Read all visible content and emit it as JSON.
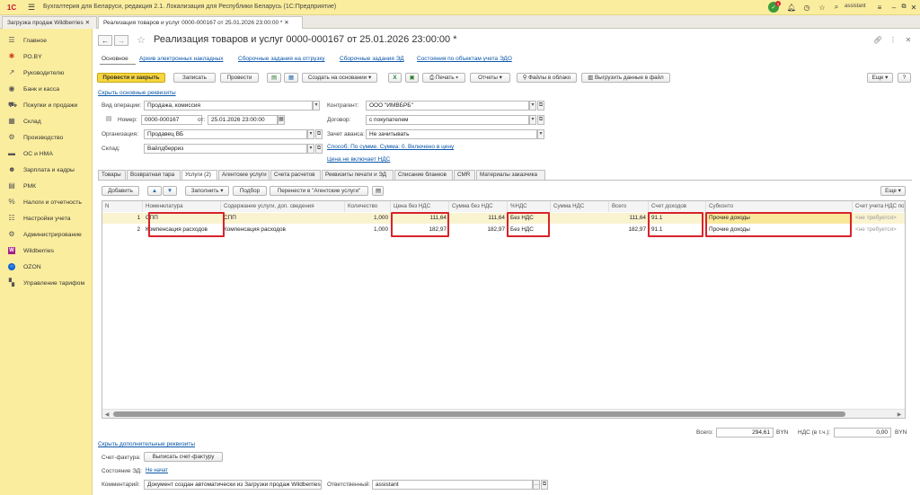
{
  "app": {
    "title": "Бухгалтерия для Беларуси, редакция 2.1. Локализация для Республики Беларусь  (1С:Предприятие)",
    "user": "assistant",
    "notify_count": "1"
  },
  "tabs": [
    {
      "label": "Загрузка продаж Wildberries ✕"
    },
    {
      "label": "Реализация товаров и услуг 0000-000167 от 25.01.2026 23:00:00 * ✕"
    }
  ],
  "sidebar": {
    "items": [
      {
        "label": "Главное"
      },
      {
        "label": "РО.BY"
      },
      {
        "label": "Руководителю"
      },
      {
        "label": "Банк и касса"
      },
      {
        "label": "Покупки и продажи"
      },
      {
        "label": "Склад"
      },
      {
        "label": "Производство"
      },
      {
        "label": "ОС и НМА"
      },
      {
        "label": "Зарплата и кадры"
      },
      {
        "label": "РМК"
      },
      {
        "label": "Налоги и отчетность"
      },
      {
        "label": "Настройки учета"
      },
      {
        "label": "Администрирование"
      },
      {
        "label": "Wildberries"
      },
      {
        "label": "OZON"
      },
      {
        "label": "Управление тарифом"
      }
    ]
  },
  "doc": {
    "title": "Реализация товаров и услуг 0000-000167 от 25.01.2026 23:00:00 *"
  },
  "subnav": [
    "Основное",
    "Архив электронных накладных",
    "Сборочные задания на отгрузку",
    "Сборочные задания ЭД",
    "Состояния по объектам учета ЭДО"
  ],
  "toolbar": {
    "post_close": "Провести и закрыть",
    "save": "Записать",
    "post": "Провести",
    "create_based": "Создать на основании",
    "print": "Печать",
    "reports": "Отчеты",
    "cloud": "Файлы в облако",
    "export": "Выгрузить данные в файл",
    "more": "Еще",
    "help": "?"
  },
  "form": {
    "hide_main": "Скрыть основные реквизиты",
    "op_label": "Вид операции:",
    "op_value": "Продажа, комиссия",
    "num_label": "Номер:",
    "num_value": "0000-000167",
    "from_label": "от:",
    "date_value": "25.01.2026 23:00:00",
    "org_label": "Организация:",
    "org_value": "Продавец ВБ",
    "wh_label": "Склад:",
    "wh_value": "Вайлдберриз",
    "contr_label": "Контрагент:",
    "contr_value": "ООО \"ИМВБРБ\"",
    "contract_label": "Договор:",
    "contract_value": "с покупателем",
    "adv_label": "Зачет аванса:",
    "adv_value": "Не зачитывать",
    "vat_method": "Способ: По сумме. Сумма: 0. Включено в цену",
    "price_vat": "Цена не включает НДС"
  },
  "form_tabs": [
    "Товары",
    "Возвратная тара",
    "Услуги (2)",
    "Агентские услуги",
    "Счета расчетов",
    "Реквизиты печати и ЭД",
    "Списание бланков",
    "CMR",
    "Материалы заказчика"
  ],
  "table_toolbar": {
    "add": "Добавить",
    "fill": "Заполнить",
    "select": "Подбор",
    "move": "Перенести в \"Агентские услуги\"",
    "more": "Еще"
  },
  "table": {
    "columns": [
      "N",
      "Номенклатура",
      "Содержание услуги, доп. сведения",
      "Количество",
      "Цена без НДС",
      "Сумма без НДС",
      "%НДС",
      "Сумма НДС",
      "Всего",
      "Счет доходов",
      "Субконто",
      "Счет учета НДС по"
    ],
    "rows": [
      [
        "1",
        "СПП",
        "СПП",
        "1,000",
        "111,64",
        "111,64",
        "Без НДС",
        "",
        "111,64",
        "91.1",
        "Прочие доходы",
        "<не требуется>"
      ],
      [
        "2",
        "Компенсация расходов",
        "Компенсация расходов",
        "1,000",
        "182,97",
        "182,97",
        "Без НДС",
        "",
        "182,97",
        "91.1",
        "Прочие доходы",
        "<не требуется>"
      ]
    ]
  },
  "totals": {
    "total_label": "Всего:",
    "total_value": "294,61",
    "currency": "BYN",
    "vat_label": "НДС (в т.ч.):",
    "vat_value": "0,00",
    "vat_currency": "BYN"
  },
  "footer": {
    "hide_extra": "Скрыть дополнительные реквизиты",
    "invoice_label": "Счет-фактура:",
    "invoice_btn": "Выписать счет-фактуру",
    "ed_label": "Состояние ЭД:",
    "ed_value": "Не начат",
    "comment_label": "Комментарий:",
    "comment_value": "Документ создан автоматически из Загрузки продаж Wildberries",
    "resp_label": "Ответственный:",
    "resp_value": "assistant"
  },
  "colors": {
    "accent": "#fbed9e",
    "highlight": "#d8232a",
    "primary_btn": "#f7d53c",
    "link": "#0a56a8"
  }
}
